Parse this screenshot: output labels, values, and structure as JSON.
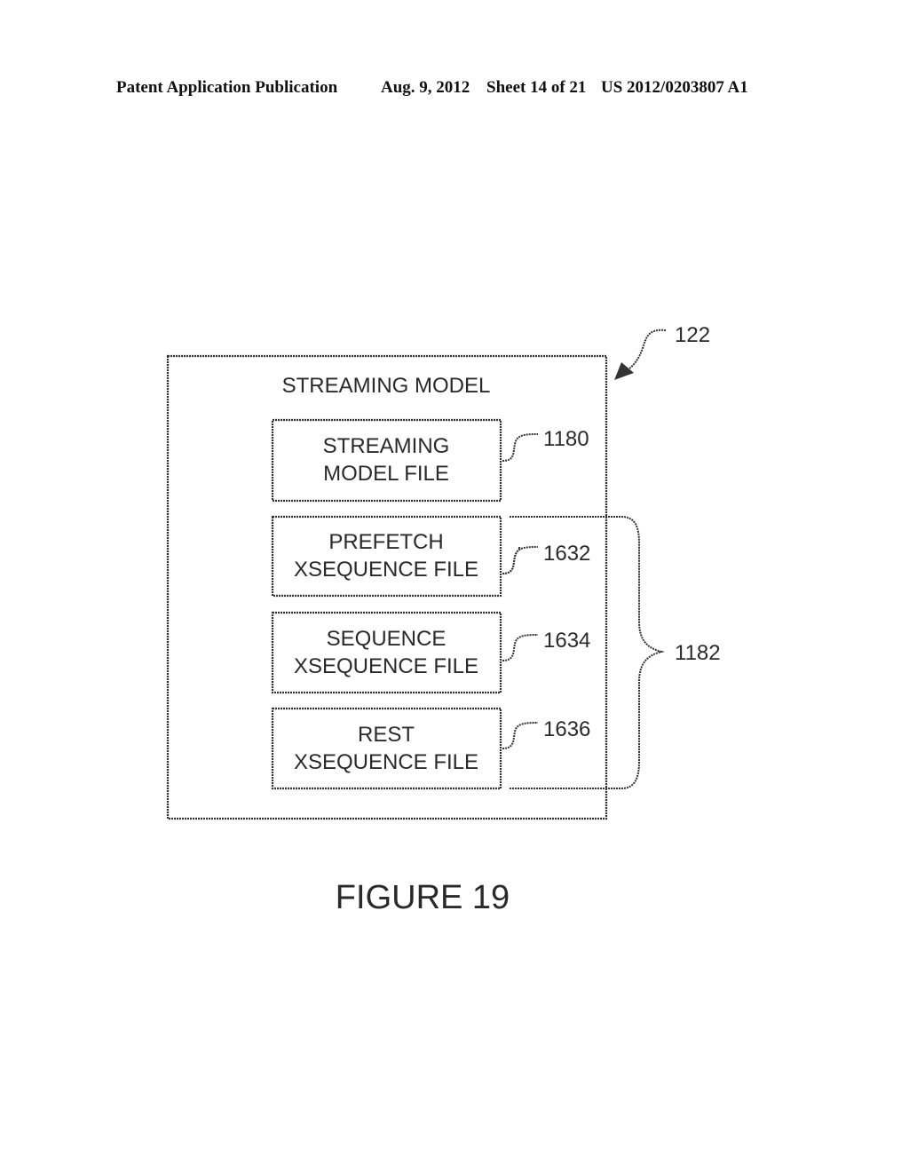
{
  "header": {
    "publication": "Patent Application Publication",
    "date": "Aug. 9, 2012",
    "sheet": "Sheet 14 of 21",
    "number": "US 2012/0203807 A1"
  },
  "diagram": {
    "outer": {
      "title": "STREAMING MODEL",
      "ref": "122"
    },
    "boxes": [
      {
        "line1": "STREAMING",
        "line2": "MODEL FILE",
        "ref": "1180"
      },
      {
        "line1": "PREFETCH",
        "line2": "XSEQUENCE FILE",
        "ref": "1632"
      },
      {
        "line1": "SEQUENCE",
        "line2": "XSEQUENCE FILE",
        "ref": "1634"
      },
      {
        "line1": "REST",
        "line2": "XSEQUENCE FILE",
        "ref": "1636"
      }
    ],
    "brace_ref": "1182"
  },
  "figure_caption": "FIGURE 19"
}
